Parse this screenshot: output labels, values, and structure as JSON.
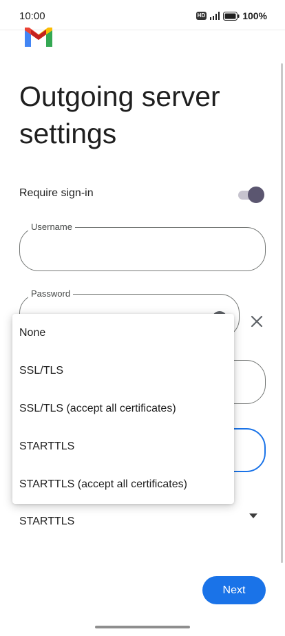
{
  "status_bar": {
    "time": "10:00",
    "hd": "HD",
    "battery": "100%"
  },
  "page": {
    "title": "Outgoing server settings"
  },
  "require_signin": {
    "label": "Require sign-in",
    "enabled": true
  },
  "username": {
    "label": "Username",
    "value": ""
  },
  "password": {
    "label": "Password",
    "value": ""
  },
  "security_type": {
    "selected": "STARTTLS",
    "options": [
      "None",
      "SSL/TLS",
      "SSL/TLS (accept all certificates)",
      "STARTTLS",
      "STARTTLS (accept all certificates)"
    ]
  },
  "actions": {
    "next": "Next"
  },
  "colors": {
    "accent": "#1a73e8",
    "toggle_thumb": "#5b5670"
  }
}
